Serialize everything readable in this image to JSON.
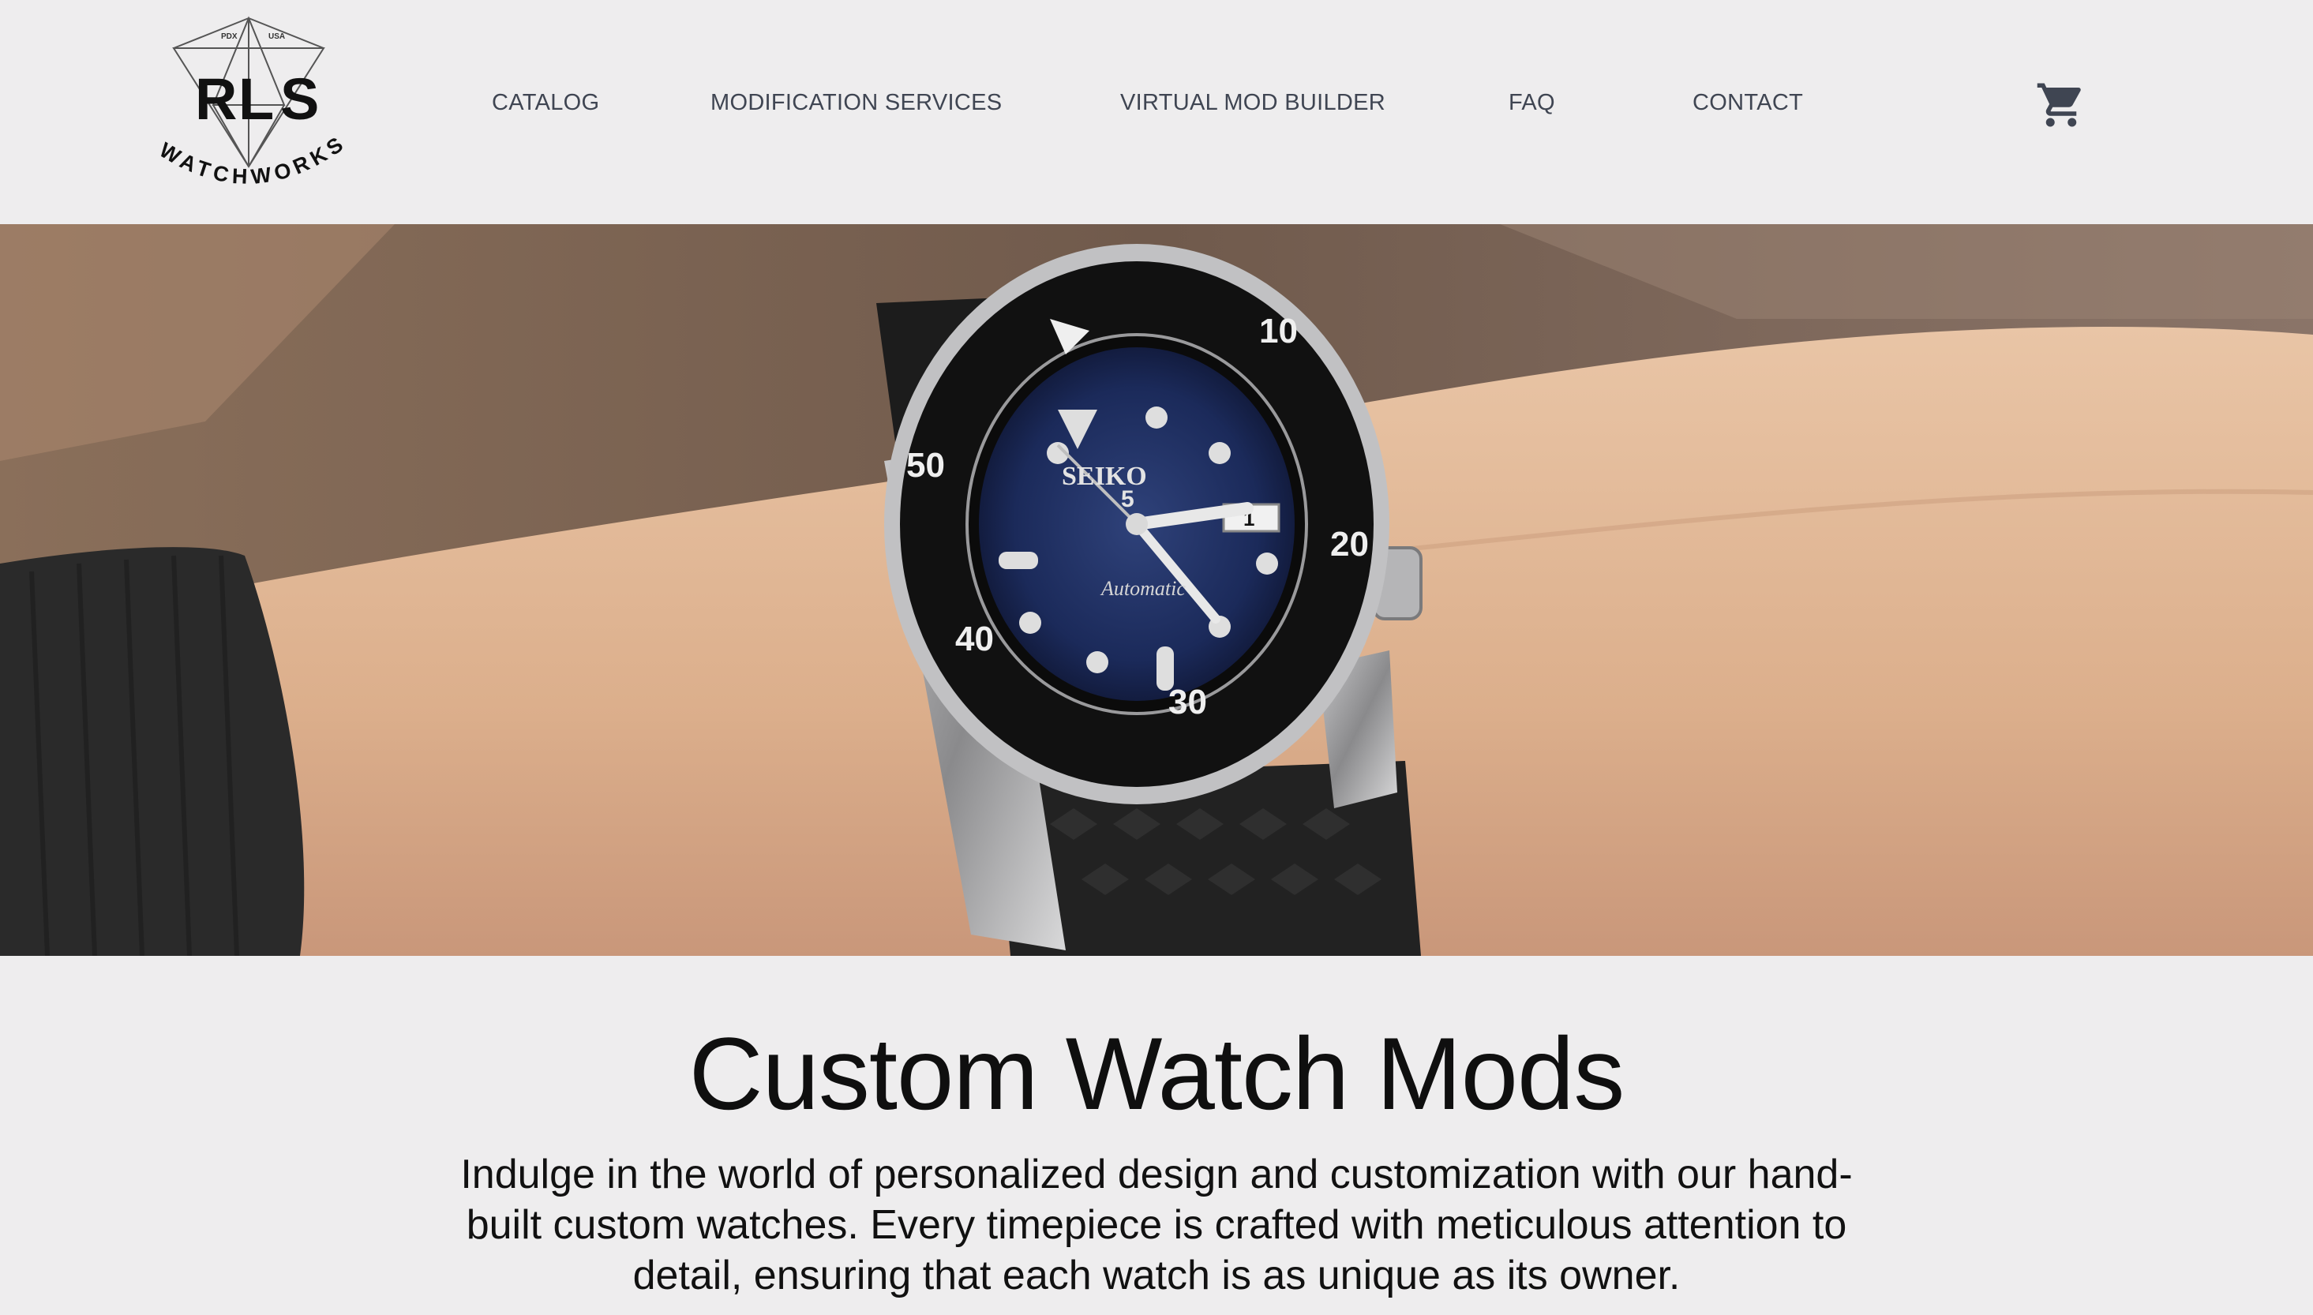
{
  "brand": {
    "logo_letters": [
      "R",
      "L",
      "S"
    ],
    "logo_arc_text": "WATCHWORKS",
    "logo_tag_left": "PDX",
    "logo_tag_right": "USA"
  },
  "nav": {
    "items": [
      {
        "label": "CATALOG"
      },
      {
        "label": "MODIFICATION SERVICES"
      },
      {
        "label": "VIRTUAL MOD BUILDER"
      },
      {
        "label": "FAQ"
      },
      {
        "label": "CONTACT"
      }
    ],
    "cart_icon": "shopping-cart-icon"
  },
  "hero": {
    "dial_brand": "SEIKO",
    "dial_model": "5",
    "dial_script": "Automatic",
    "date": "1",
    "bezel_numbers": [
      "10",
      "20",
      "30",
      "40",
      "50"
    ]
  },
  "intro": {
    "title": "Custom Watch Mods",
    "description": "Indulge in the world of personalized design and customization with our hand-built custom watches. Every timepiece is crafted with meticulous attention to detail, ensuring that each watch is as unique as its owner."
  },
  "colors": {
    "background": "#eeedee",
    "nav_text": "#3f4552",
    "title_text": "#0f0f0f",
    "dial_blue": "#1b2a5a"
  }
}
